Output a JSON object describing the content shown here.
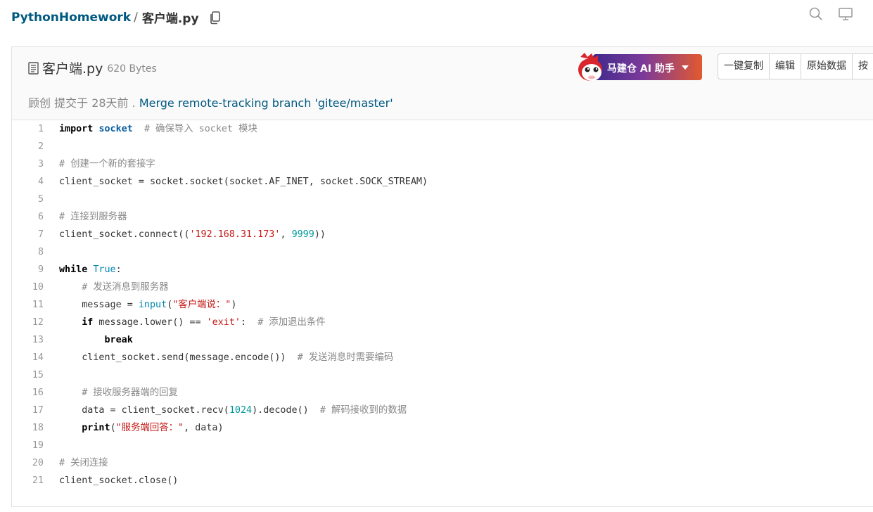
{
  "breadcrumb": {
    "repo": "PythonHomework",
    "separator": "/",
    "file": "客户端.py"
  },
  "icons": {
    "copy": "copy-icon",
    "search": "search-icon",
    "monitor": "monitor-icon",
    "file": "file-text-icon",
    "mascot": "mascot-icon"
  },
  "file_header": {
    "name": "客户端.py",
    "size": "620 Bytes",
    "commit_author": "顾创",
    "commit_time": "提交于 28天前 .",
    "commit_message": "Merge remote-tracking branch 'gitee/master'"
  },
  "ai_button": {
    "label": "马建仓 AI 助手"
  },
  "actions": [
    "一键复制",
    "编辑",
    "原始数据",
    "按"
  ],
  "colors": {
    "link": "#005980",
    "keyword": "#000000",
    "string": "#c41a16",
    "number": "#009999",
    "comment": "#888888",
    "builtin": "#0086b3"
  },
  "code_lines": [
    {
      "no": "1",
      "tokens": [
        {
          "t": "import",
          "c": "kw"
        },
        {
          "t": " ",
          "c": ""
        },
        {
          "t": "socket",
          "c": "nm-b"
        },
        {
          "t": "  ",
          "c": ""
        },
        {
          "t": "# 确保导入 socket 模块",
          "c": "cm"
        }
      ]
    },
    {
      "no": "2",
      "tokens": []
    },
    {
      "no": "3",
      "tokens": [
        {
          "t": "# 创建一个新的套接字",
          "c": "cm"
        }
      ]
    },
    {
      "no": "4",
      "tokens": [
        {
          "t": "client_socket = socket.socket(socket.AF_INET, socket.SOCK_STREAM)",
          "c": ""
        }
      ]
    },
    {
      "no": "5",
      "tokens": []
    },
    {
      "no": "6",
      "tokens": [
        {
          "t": "# 连接到服务器",
          "c": "cm"
        }
      ]
    },
    {
      "no": "7",
      "tokens": [
        {
          "t": "client_socket.connect((",
          "c": ""
        },
        {
          "t": "'192.168.31.173'",
          "c": "st"
        },
        {
          "t": ", ",
          "c": ""
        },
        {
          "t": "9999",
          "c": "nu"
        },
        {
          "t": "))",
          "c": ""
        }
      ]
    },
    {
      "no": "8",
      "tokens": []
    },
    {
      "no": "9",
      "tokens": [
        {
          "t": "while",
          "c": "kw"
        },
        {
          "t": " ",
          "c": ""
        },
        {
          "t": "True",
          "c": "bi"
        },
        {
          "t": ":",
          "c": ""
        }
      ]
    },
    {
      "no": "10",
      "tokens": [
        {
          "t": "    ",
          "c": ""
        },
        {
          "t": "# 发送消息到服务器",
          "c": "cm"
        }
      ]
    },
    {
      "no": "11",
      "tokens": [
        {
          "t": "    message = ",
          "c": ""
        },
        {
          "t": "input",
          "c": "bi"
        },
        {
          "t": "(",
          "c": ""
        },
        {
          "t": "\"客户端说：\"",
          "c": "st"
        },
        {
          "t": ")",
          "c": ""
        }
      ]
    },
    {
      "no": "12",
      "tokens": [
        {
          "t": "    ",
          "c": ""
        },
        {
          "t": "if",
          "c": "kw"
        },
        {
          "t": " message.lower() == ",
          "c": ""
        },
        {
          "t": "'exit'",
          "c": "st"
        },
        {
          "t": ":  ",
          "c": ""
        },
        {
          "t": "# 添加退出条件",
          "c": "cm"
        }
      ]
    },
    {
      "no": "13",
      "tokens": [
        {
          "t": "        ",
          "c": ""
        },
        {
          "t": "break",
          "c": "kw"
        }
      ]
    },
    {
      "no": "14",
      "tokens": [
        {
          "t": "    client_socket.send(message.encode())  ",
          "c": ""
        },
        {
          "t": "# 发送消息时需要编码",
          "c": "cm"
        }
      ]
    },
    {
      "no": "15",
      "tokens": []
    },
    {
      "no": "16",
      "tokens": [
        {
          "t": "    ",
          "c": ""
        },
        {
          "t": "# 接收服务器端的回复",
          "c": "cm"
        }
      ]
    },
    {
      "no": "17",
      "tokens": [
        {
          "t": "    data = client_socket.recv(",
          "c": ""
        },
        {
          "t": "1024",
          "c": "nu"
        },
        {
          "t": ").decode()  ",
          "c": ""
        },
        {
          "t": "# 解码接收到的数据",
          "c": "cm"
        }
      ]
    },
    {
      "no": "18",
      "tokens": [
        {
          "t": "    ",
          "c": ""
        },
        {
          "t": "print",
          "c": "kw"
        },
        {
          "t": "(",
          "c": ""
        },
        {
          "t": "\"服务端回答：\"",
          "c": "st"
        },
        {
          "t": ", data)",
          "c": ""
        }
      ]
    },
    {
      "no": "19",
      "tokens": []
    },
    {
      "no": "20",
      "tokens": [
        {
          "t": "# 关闭连接",
          "c": "cm"
        }
      ]
    },
    {
      "no": "21",
      "tokens": [
        {
          "t": "client_socket.close()",
          "c": ""
        }
      ]
    }
  ]
}
